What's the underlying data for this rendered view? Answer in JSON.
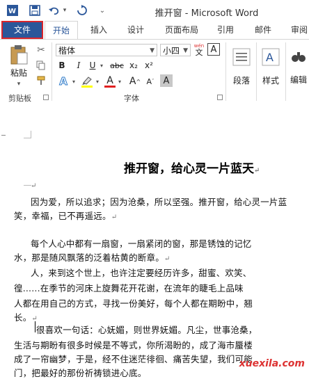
{
  "window": {
    "title": "推开窗 - Microsoft Word"
  },
  "quick_access": {
    "app_icon": "word-icon",
    "save_icon": "save-icon",
    "undo_icon": "undo-icon",
    "redo_icon": "redo-icon",
    "customize_icon": "chevron-down-icon"
  },
  "tabs": [
    {
      "label": "文件"
    },
    {
      "label": "开始"
    },
    {
      "label": "插入"
    },
    {
      "label": "设计"
    },
    {
      "label": "页面布局"
    },
    {
      "label": "引用"
    },
    {
      "label": "邮件"
    },
    {
      "label": "审阅"
    }
  ],
  "ribbon": {
    "clipboard": {
      "paste_label": "粘贴",
      "group_label": "剪贴板"
    },
    "font": {
      "font_name": "楷体",
      "font_size": "小四",
      "wen_label": "wén",
      "wen_char": "文",
      "bold": "B",
      "italic": "I",
      "underline": "U",
      "strikethrough": "abc",
      "subscript": "x₂",
      "superscript": "x²",
      "text_effect": "A",
      "font_color": "A",
      "grow": "A",
      "shrink": "A",
      "char_shading": "A",
      "group_label": "字体",
      "highlight_color": "#ffff00",
      "font_color_value": "#e02020"
    },
    "paragraph": {
      "label": "段落"
    },
    "styles": {
      "label": "样式"
    },
    "editing": {
      "label": "编辑"
    }
  },
  "document": {
    "heading": "推开窗，给心灵一片蓝天",
    "paragraphs": [
      "因为爱，所以追求；因为沧桑，所以坚强。推开窗，给心灵一片蓝",
      "笑，幸福，已不再遥远。",
      "每个人心中都有一扇窗，一扇紧闭的窗，那是锈蚀的记忆",
      "水，那是随风飘落的泛着枯黄的断章。",
      "人，来到这个世上，也许注定要经历许多，甜蜜、欢笑、",
      "徨......在季节的河床上旋舞花开花谢，在流年的睫毛上品味",
      "人都在用自己的方式，寻找一份美好，每个人都在期盼中，翘",
      "长。",
      "很喜欢一句话：心妩媚，则世界妩媚。凡尘，世事沧桑，",
      "生活与期盼有很多时候是不等式，你所渴盼的，成了海市蜃楼",
      "成了一帘幽梦，于是，经不住迷茫徘徊、痛苦失望，我们可能",
      "门，把最好的那份祈祷锁进心底。"
    ]
  },
  "watermark": {
    "text": "xuexila.com"
  }
}
